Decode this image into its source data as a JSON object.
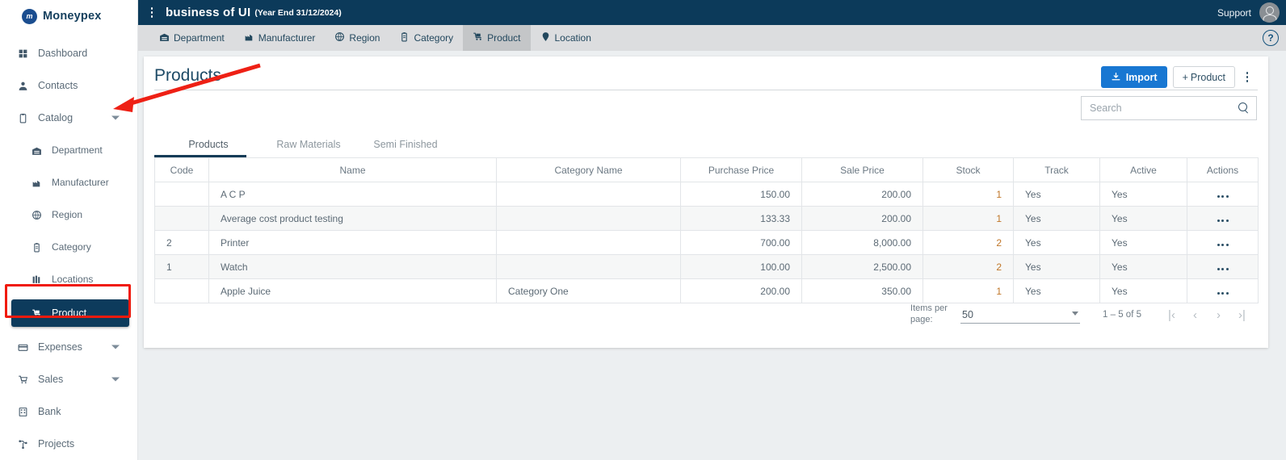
{
  "brand": {
    "logo_initials": "m",
    "name": "Moneypex",
    "logo_color": "#1a4d8f"
  },
  "sidebar": {
    "items": [
      {
        "label": "Dashboard",
        "icon": "grid-icon",
        "glyph": "▦",
        "level": 1,
        "caret": false,
        "active": false
      },
      {
        "label": "Contacts",
        "icon": "person-icon",
        "glyph": "A",
        "level": 1,
        "caret": false,
        "active": false
      },
      {
        "label": "Catalog",
        "icon": "clipboard-icon",
        "glyph": "B",
        "level": 1,
        "caret": true,
        "active": false
      },
      {
        "label": "Department",
        "icon": "warehouse-icon",
        "glyph": "C",
        "level": 2,
        "caret": false,
        "active": false
      },
      {
        "label": "Manufacturer",
        "icon": "factory-icon",
        "glyph": "D",
        "level": 2,
        "caret": false,
        "active": false
      },
      {
        "label": "Region",
        "icon": "globe-icon",
        "glyph": "E",
        "level": 2,
        "caret": false,
        "active": false
      },
      {
        "label": "Category",
        "icon": "category-icon",
        "glyph": "F",
        "level": 2,
        "caret": false,
        "active": false
      },
      {
        "label": "Locations",
        "icon": "locations-icon",
        "glyph": "G",
        "level": 2,
        "caret": false,
        "active": false
      },
      {
        "label": "Product",
        "icon": "product-icon",
        "glyph": "H",
        "level": 2,
        "caret": false,
        "active": true
      },
      {
        "label": "Expenses",
        "icon": "expenses-icon",
        "glyph": "I",
        "level": 1,
        "caret": true,
        "active": false
      },
      {
        "label": "Sales",
        "icon": "cart-icon",
        "glyph": "J",
        "level": 1,
        "caret": true,
        "active": false
      },
      {
        "label": "Bank",
        "icon": "bank-icon",
        "glyph": "K",
        "level": 1,
        "caret": false,
        "active": false
      },
      {
        "label": "Projects",
        "icon": "projects-icon",
        "glyph": "L",
        "level": 1,
        "caret": false,
        "active": false
      }
    ],
    "highlight_color": "#f01a0d",
    "active_bg": "#0d3b5c"
  },
  "topbar": {
    "menu_icon": "kebab-menu-icon",
    "business_name": "business of UI",
    "year_end": "(Year End 31/12/2024)",
    "support_label": "Support",
    "avatar_icon": "user-avatar-icon",
    "bg_color": "#0c3a5a"
  },
  "module_tabs": {
    "items": [
      {
        "label": "Department",
        "icon": "warehouse-icon",
        "glyph": "C",
        "selected": false
      },
      {
        "label": "Manufacturer",
        "icon": "factory-icon",
        "glyph": "D",
        "selected": false
      },
      {
        "label": "Region",
        "icon": "globe-icon",
        "glyph": "E",
        "selected": false
      },
      {
        "label": "Category",
        "icon": "category-icon",
        "glyph": "F",
        "selected": false
      },
      {
        "label": "Product",
        "icon": "product-icon",
        "glyph": "H",
        "selected": true
      },
      {
        "label": "Location",
        "icon": "pin-icon",
        "glyph": "M",
        "selected": false
      }
    ],
    "help_label": "?",
    "help_icon": "help-circle-icon",
    "bg_color": "#dcdddf"
  },
  "page": {
    "title": "Products",
    "import_label": "Import",
    "import_icon": "download-icon",
    "add_product_label": "Product",
    "add_product_icon": "plus-icon",
    "more_icon": "kebab-menu-icon",
    "accent_color": "#1877d2"
  },
  "search": {
    "value": "",
    "placeholder": "Search",
    "icon": "search-icon"
  },
  "subtabs": [
    {
      "label": "Products",
      "active": true
    },
    {
      "label": "Raw Materials",
      "active": false
    },
    {
      "label": "Semi Finished",
      "active": false
    }
  ],
  "table": {
    "columns": [
      "Code",
      "Name",
      "Category Name",
      "Purchase Price",
      "Sale Price",
      "Stock",
      "Track",
      "Active",
      "Actions"
    ],
    "rows": [
      {
        "code": "",
        "name": "A C P",
        "category": "",
        "purchase": "150.00",
        "sale": "200.00",
        "stock": "1",
        "track": "Yes",
        "active": "Yes",
        "actions_icon": "row-actions-icon"
      },
      {
        "code": "",
        "name": "Average cost product testing",
        "category": "",
        "purchase": "133.33",
        "sale": "200.00",
        "stock": "1",
        "track": "Yes",
        "active": "Yes",
        "actions_icon": "row-actions-icon"
      },
      {
        "code": "2",
        "name": "Printer",
        "category": "",
        "purchase": "700.00",
        "sale": "8,000.00",
        "stock": "2",
        "track": "Yes",
        "active": "Yes",
        "actions_icon": "row-actions-icon"
      },
      {
        "code": "1",
        "name": "Watch",
        "category": "",
        "purchase": "100.00",
        "sale": "2,500.00",
        "stock": "2",
        "track": "Yes",
        "active": "Yes",
        "actions_icon": "row-actions-icon"
      },
      {
        "code": "",
        "name": "Apple Juice",
        "category": "Category One",
        "purchase": "200.00",
        "sale": "350.00",
        "stock": "1",
        "track": "Yes",
        "active": "Yes",
        "actions_icon": "row-actions-icon"
      }
    ],
    "stock_color": "#c07628"
  },
  "pagination": {
    "items_per_page_label": "Items per page:",
    "items_per_page_value": "50",
    "range_label": "1 – 5 of 5",
    "first_icon": "first-page-icon",
    "prev_icon": "previous-page-icon",
    "next_icon": "next-page-icon",
    "last_icon": "last-page-icon",
    "first_glyph": "|‹",
    "prev_glyph": "‹",
    "next_glyph": "›",
    "last_glyph": "›|"
  },
  "annotation": {
    "type": "red-arrow",
    "color": "#ee2015",
    "points_at": "catalog-dropdown-caret"
  }
}
